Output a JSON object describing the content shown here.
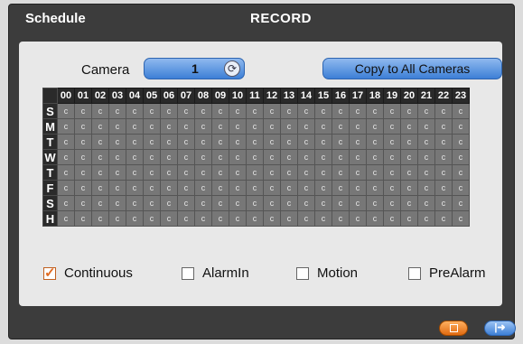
{
  "titlebar": {
    "left_title": "Schedule",
    "center_title": "RECORD"
  },
  "camera": {
    "label": "Camera",
    "value": "1",
    "spin_icon": "spin-refresh-icon"
  },
  "copy_button": {
    "label": "Copy to All Cameras"
  },
  "grid": {
    "hours": [
      "00",
      "01",
      "02",
      "03",
      "04",
      "05",
      "06",
      "07",
      "08",
      "09",
      "10",
      "11",
      "12",
      "13",
      "14",
      "15",
      "16",
      "17",
      "18",
      "19",
      "20",
      "21",
      "22",
      "23"
    ],
    "days": [
      "S",
      "M",
      "T",
      "W",
      "T",
      "F",
      "S",
      "H"
    ],
    "cell_value": "c"
  },
  "options": [
    {
      "label": "Continuous",
      "checked": true
    },
    {
      "label": "AlarmIn",
      "checked": false
    },
    {
      "label": "Motion",
      "checked": false
    },
    {
      "label": "PreAlarm",
      "checked": false
    }
  ],
  "buttons": {
    "save_icon": "save-icon",
    "exit_icon": "exit-arrow-icon"
  },
  "colors": {
    "accent_blue": "#3d7fd6",
    "accent_orange": "#e06a10",
    "window_bg": "#3c3c3c"
  }
}
